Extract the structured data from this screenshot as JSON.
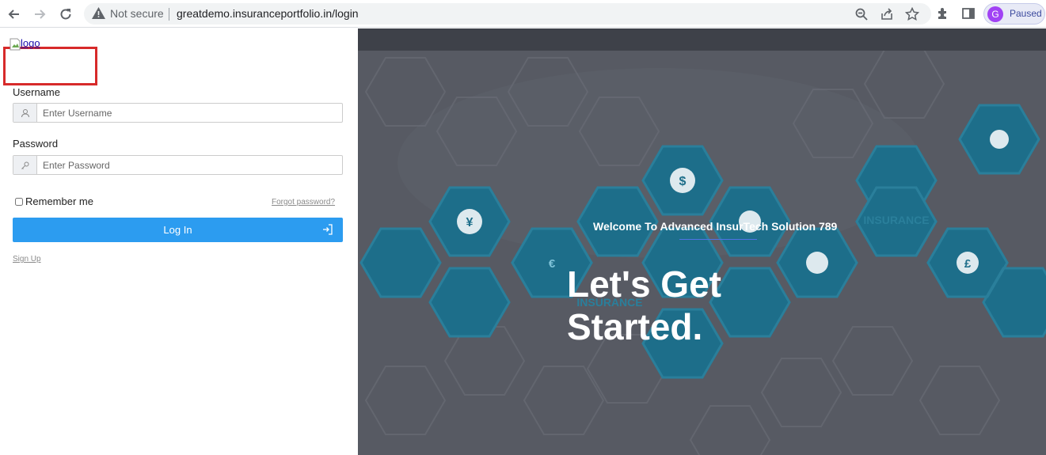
{
  "browser": {
    "security_label": "Not secure",
    "url": "greatdemo.insuranceportfolio.in/login",
    "profile_initial": "G",
    "profile_status": "Paused"
  },
  "login": {
    "logo_alt": "logo",
    "username_label": "Username",
    "username_placeholder": "Enter Username",
    "password_label": "Password",
    "password_placeholder": "Enter Password",
    "remember_label": "Remember me",
    "forgot_label": "Forgot password?",
    "login_button": "Log In",
    "signup_label": "Sign Up"
  },
  "hero": {
    "welcome": "Welcome To Advanced InsurTech Solution 789",
    "headline": "Let's Get Started.",
    "hexagon_texts": [
      "INSURANCE",
      "INSURANCE"
    ]
  },
  "colors": {
    "primary_button": "#2c9cf0",
    "hero_bg": "#575a63",
    "hex_tile": "#1d6e8a",
    "highlight_frame": "#d72a2a"
  }
}
